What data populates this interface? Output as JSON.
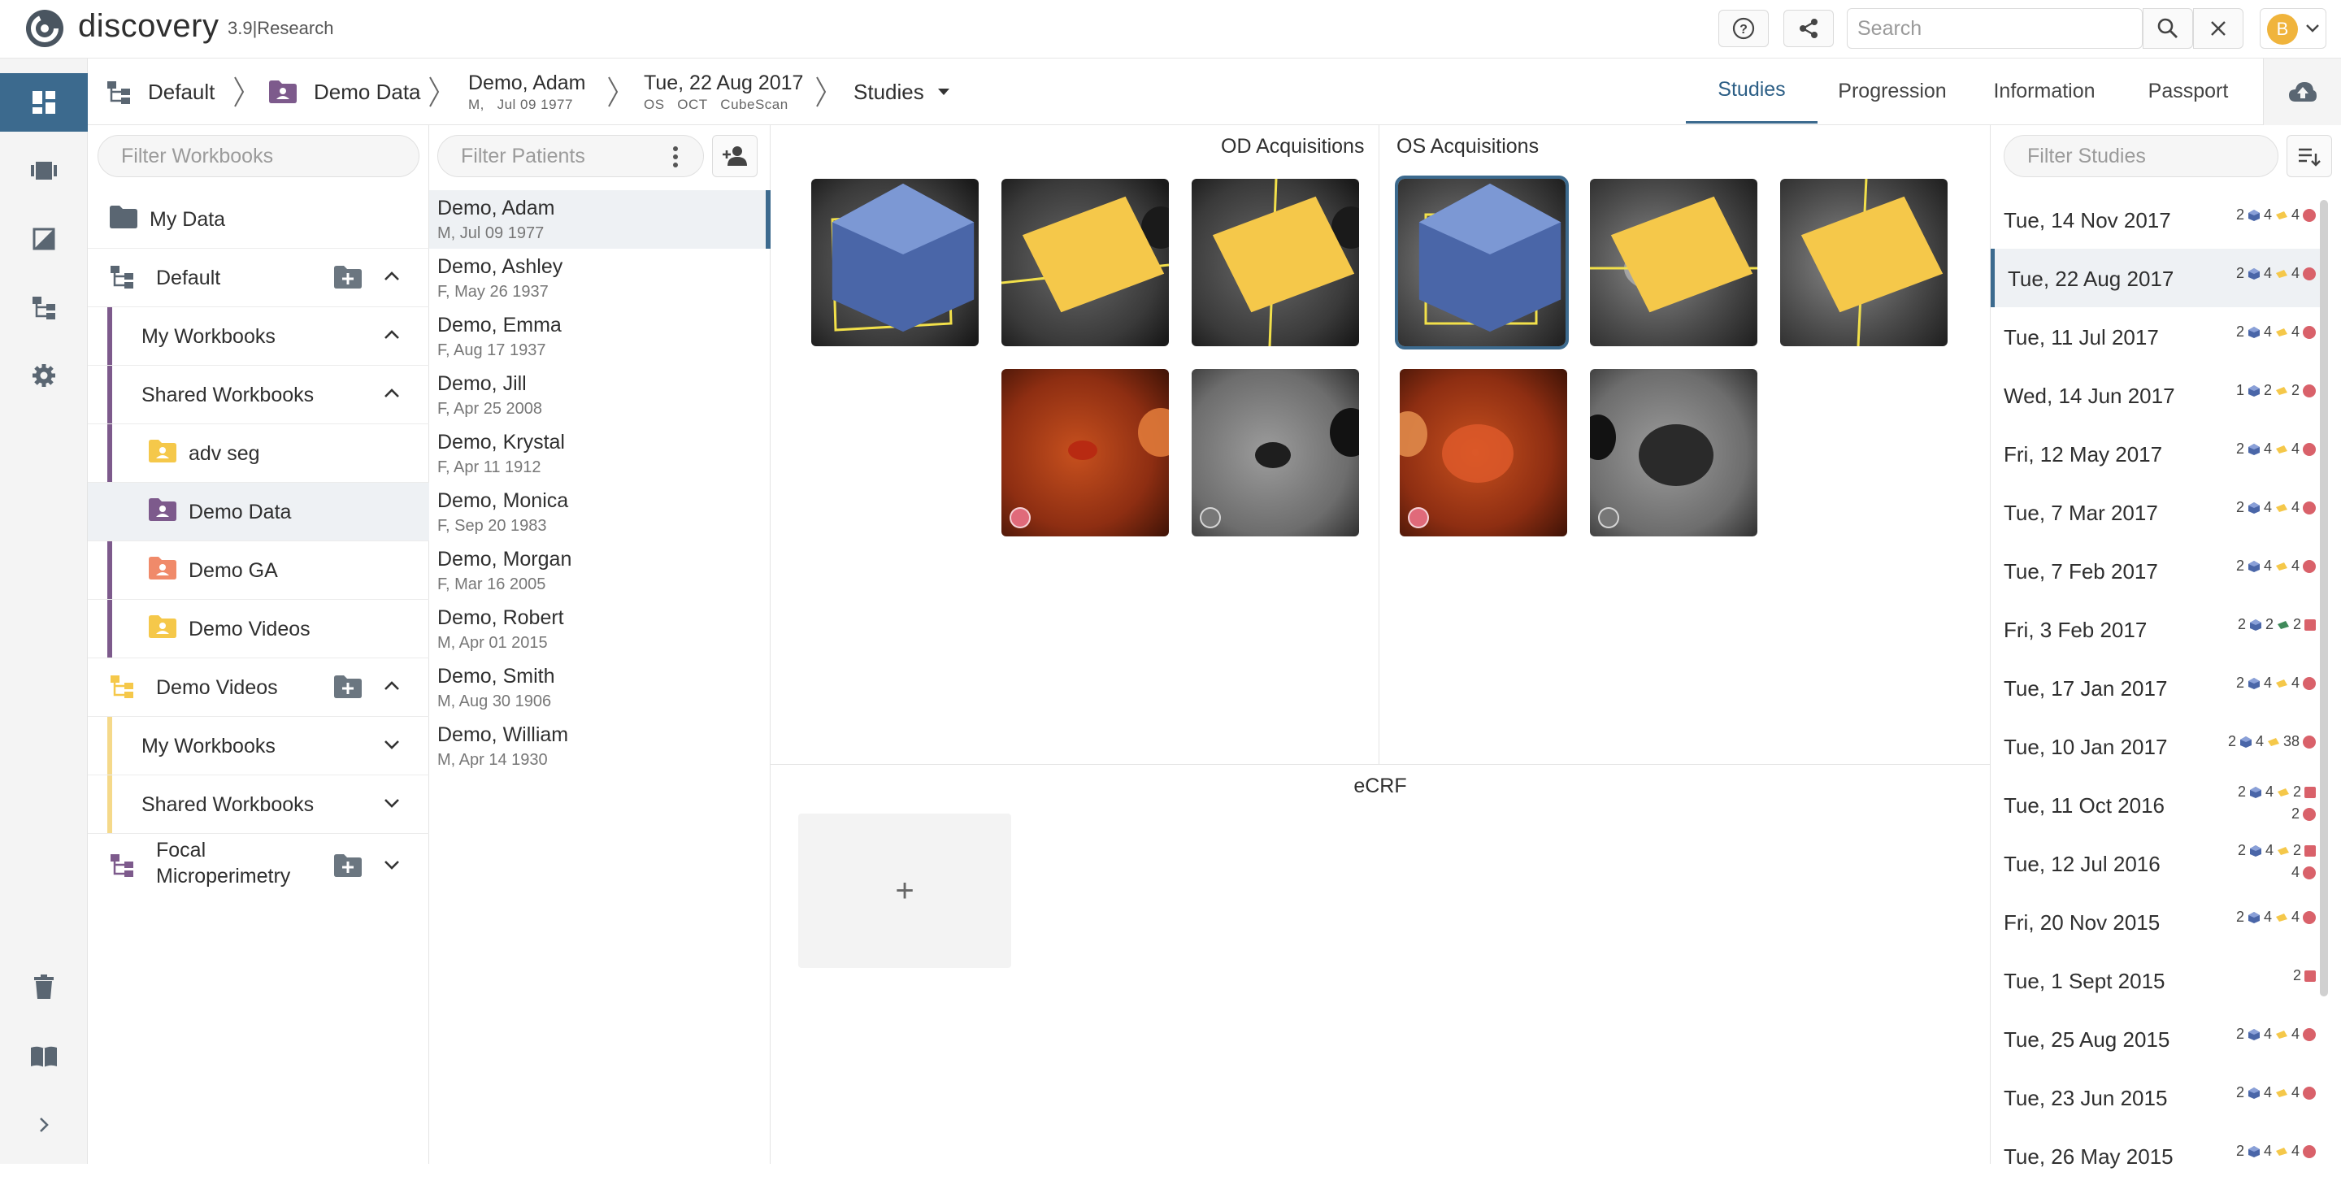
{
  "app": {
    "name": "discovery",
    "version": "3.9|Research",
    "user_initial": "B"
  },
  "search": {
    "placeholder": "Search"
  },
  "breadcrumb": {
    "project": "Default",
    "workbook": "Demo Data",
    "patient_name": "Demo, Adam",
    "patient_sex": "M,",
    "patient_dob": "Jul 09 1977",
    "study_date": "Tue, 22 Aug 2017",
    "study_eye": "OS",
    "study_modality": "OCT",
    "study_protocol": "CubeScan",
    "view_selector": "Studies"
  },
  "tabs": [
    "Studies",
    "Progression",
    "Information",
    "Passport"
  ],
  "workbooks": {
    "filter_placeholder": "Filter Workbooks",
    "my_data": "My Data",
    "default_project": "Default",
    "my_workbooks": "My Workbooks",
    "shared_workbooks": "Shared Workbooks",
    "shared_items": [
      "adv seg",
      "Demo Data",
      "Demo GA",
      "Demo Videos"
    ],
    "demo_videos_project": "Demo Videos",
    "dv_my_workbooks": "My Workbooks",
    "dv_shared_workbooks": "Shared Workbooks",
    "focal_project_line1": "Focal",
    "focal_project_line2": "Microperimetry"
  },
  "patients": {
    "filter_placeholder": "Filter Patients",
    "items": [
      {
        "name": "Demo, Adam",
        "info": "M, Jul 09 1977"
      },
      {
        "name": "Demo, Ashley",
        "info": "F, May 26 1937"
      },
      {
        "name": "Demo, Emma",
        "info": "F, Aug 17 1937"
      },
      {
        "name": "Demo, Jill",
        "info": "F, Apr 25 2008"
      },
      {
        "name": "Demo, Krystal",
        "info": "F, Apr 11 1912"
      },
      {
        "name": "Demo, Monica",
        "info": "F, Sep 20 1983"
      },
      {
        "name": "Demo, Morgan",
        "info": "F, Mar 16 2005"
      },
      {
        "name": "Demo, Robert",
        "info": "M, Apr 01 2015"
      },
      {
        "name": "Demo, Smith",
        "info": "M, Aug 30 1906"
      },
      {
        "name": "Demo, William",
        "info": "M, Apr 14 1930"
      }
    ]
  },
  "acquisitions": {
    "od_title": "OD Acquisitions",
    "os_title": "OS Acquisitions"
  },
  "ecrf": {
    "title": "eCRF",
    "add_symbol": "+"
  },
  "studies": {
    "filter_placeholder": "Filter Studies",
    "items": [
      {
        "date": "Tue, 14 Nov 2017",
        "c1": "2",
        "c2": "4",
        "c3": "4"
      },
      {
        "date": "Tue, 22 Aug 2017",
        "c1": "2",
        "c2": "4",
        "c3": "4"
      },
      {
        "date": "Tue, 11 Jul 2017",
        "c1": "2",
        "c2": "4",
        "c3": "4"
      },
      {
        "date": "Wed, 14 Jun 2017",
        "c1": "1",
        "c2": "2",
        "c3": "2"
      },
      {
        "date": "Fri, 12 May 2017",
        "c1": "2",
        "c2": "4",
        "c3": "4"
      },
      {
        "date": "Tue, 7 Mar 2017",
        "c1": "2",
        "c2": "4",
        "c3": "4"
      },
      {
        "date": "Tue, 7 Feb 2017",
        "c1": "2",
        "c2": "4",
        "c3": "4"
      },
      {
        "date": "Fri, 3 Feb 2017",
        "c1": "2",
        "c2": "2",
        "c3": "2"
      },
      {
        "date": "Tue, 17 Jan 2017",
        "c1": "2",
        "c2": "4",
        "c3": "4"
      },
      {
        "date": "Tue, 10 Jan 2017",
        "c1": "2",
        "c2": "4",
        "c3": "38"
      },
      {
        "date": "Tue, 11 Oct 2016",
        "c1": "2",
        "c2": "4",
        "c3": "2",
        "c4": "2"
      },
      {
        "date": "Tue, 12 Jul 2016",
        "c1": "2",
        "c2": "4",
        "c3": "2",
        "c4": "4"
      },
      {
        "date": "Fri, 20 Nov 2015",
        "c1": "2",
        "c2": "4",
        "c3": "4"
      },
      {
        "date": "Tue, 1 Sept 2015",
        "c3": "2"
      },
      {
        "date": "Tue, 25 Aug 2015",
        "c1": "2",
        "c2": "4",
        "c3": "4"
      },
      {
        "date": "Tue, 23 Jun 2015",
        "c1": "2",
        "c2": "4",
        "c3": "4"
      },
      {
        "date": "Tue, 26 May 2015",
        "c1": "2",
        "c2": "4",
        "c3": "4"
      }
    ]
  },
  "colors": {
    "accent": "#3c6a8e",
    "workbook_purple": "#7d5a8c",
    "folder_yellow": "#f5c84a",
    "folder_orange": "#f08a6a",
    "status_red": "#d9616a"
  }
}
